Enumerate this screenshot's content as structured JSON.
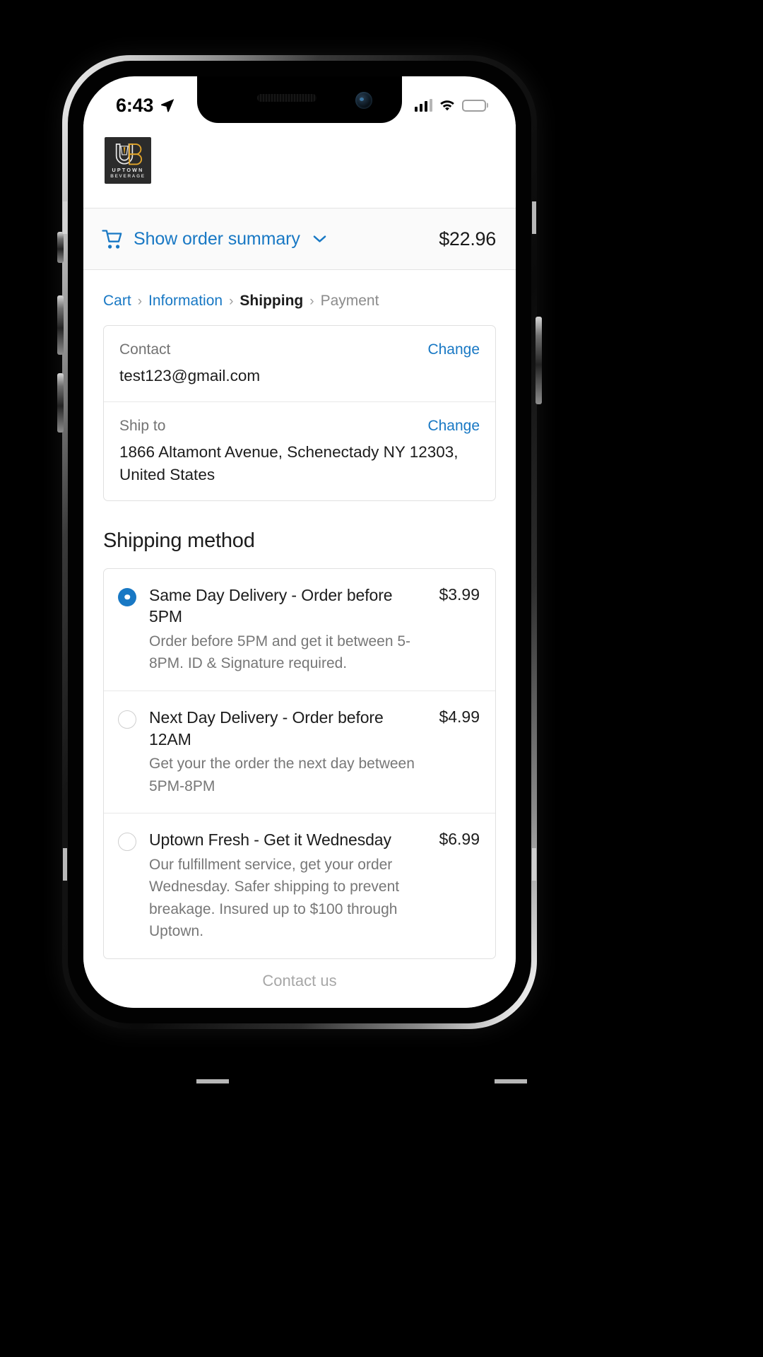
{
  "status_bar": {
    "time": "6:43",
    "location_icon": "location-arrow-icon",
    "signal_icon": "cellular-signal-icon",
    "wifi_icon": "wifi-icon",
    "battery_icon": "battery-icon",
    "battery_color": "#f5c518"
  },
  "brand": {
    "logo_icon": "uptown-beverage-logo",
    "logo_line1": "UPTOWN",
    "logo_line2": "BEVERAGE",
    "logo_bg": "#2b2b2b",
    "logo_accent": "#e0a42b"
  },
  "order_summary": {
    "cart_icon": "shopping-cart-icon",
    "toggle_label": "Show order summary",
    "chevron_icon": "chevron-down-icon",
    "total": "$22.96",
    "link_color": "#1878c4"
  },
  "breadcrumb": {
    "separator": "›",
    "items": [
      {
        "label": "Cart",
        "state": "link"
      },
      {
        "label": "Information",
        "state": "link"
      },
      {
        "label": "Shipping",
        "state": "current"
      },
      {
        "label": "Payment",
        "state": "upcoming"
      }
    ]
  },
  "review": {
    "rows": [
      {
        "label": "Contact",
        "value": "test123@gmail.com",
        "change_label": "Change"
      },
      {
        "label": "Ship to",
        "value": "1866 Altamont Avenue, Schenectady NY 12303, United States",
        "change_label": "Change"
      }
    ]
  },
  "shipping": {
    "section_title": "Shipping method",
    "options": [
      {
        "name": "Same Day Delivery - Order before 5PM",
        "description": "Order before 5PM and get it between 5-8PM. ID & Signature required.",
        "price": "$3.99",
        "selected": true
      },
      {
        "name": "Next Day Delivery - Order before 12AM",
        "description": "Get your the order the next day between 5PM-8PM",
        "price": "$4.99",
        "selected": false
      },
      {
        "name": "Uptown Fresh - Get it Wednesday",
        "description": "Our fulfillment service, get your order Wednesday. Safer shipping to prevent breakage. Insured up to $100 through Uptown.",
        "price": "$6.99",
        "selected": false
      }
    ],
    "partial_next": "Contact us"
  }
}
